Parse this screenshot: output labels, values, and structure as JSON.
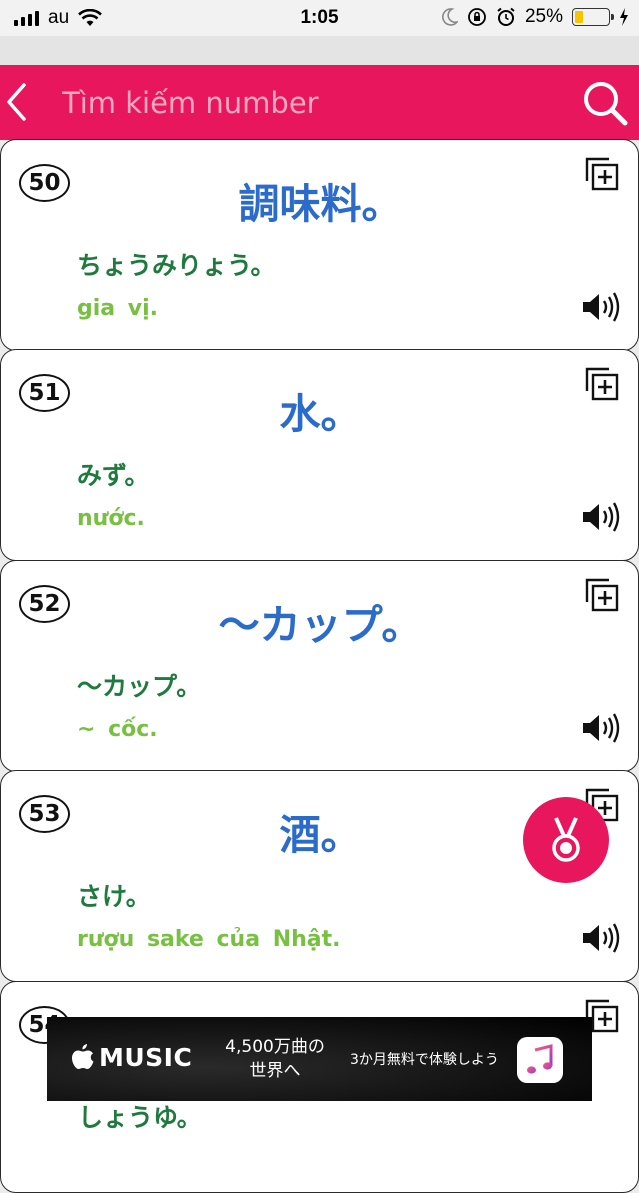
{
  "status_bar": {
    "carrier": "au",
    "time": "1:05",
    "battery_percent": "25%",
    "battery_level": 0.25
  },
  "search": {
    "placeholder": "Tìm kiếm number",
    "value": ""
  },
  "entries": [
    {
      "number": "50",
      "kanji": "調味料。",
      "reading": "ちょうみりょう。",
      "meaning": "gia vị."
    },
    {
      "number": "51",
      "kanji": "水。",
      "reading": "みず。",
      "meaning": "nước."
    },
    {
      "number": "52",
      "kanji": "～カップ。",
      "reading": "～カップ。",
      "meaning": "~ cốc."
    },
    {
      "number": "53",
      "kanji": "酒。",
      "reading": "さけ。",
      "meaning": "rượu sake của Nhật."
    },
    {
      "number": "54",
      "kanji": "",
      "reading": "しょうゆ。",
      "meaning": ""
    }
  ],
  "ad": {
    "brand": "MUSIC",
    "line1": "4,500万曲の",
    "line2": "世界へ",
    "cta": "3か月無料で体験しよう"
  },
  "colors": {
    "accent": "#e8175d",
    "kanji": "#2b6bc9",
    "reading": "#1f7a3e",
    "meaning": "#77c042"
  },
  "icons": [
    "wifi-icon",
    "moon-icon",
    "rotation-lock-icon",
    "alarm-icon",
    "charging-icon",
    "back-icon",
    "search-icon",
    "add-to-list-icon",
    "speaker-icon",
    "medal-icon",
    "apple-logo-icon",
    "music-note-icon"
  ]
}
